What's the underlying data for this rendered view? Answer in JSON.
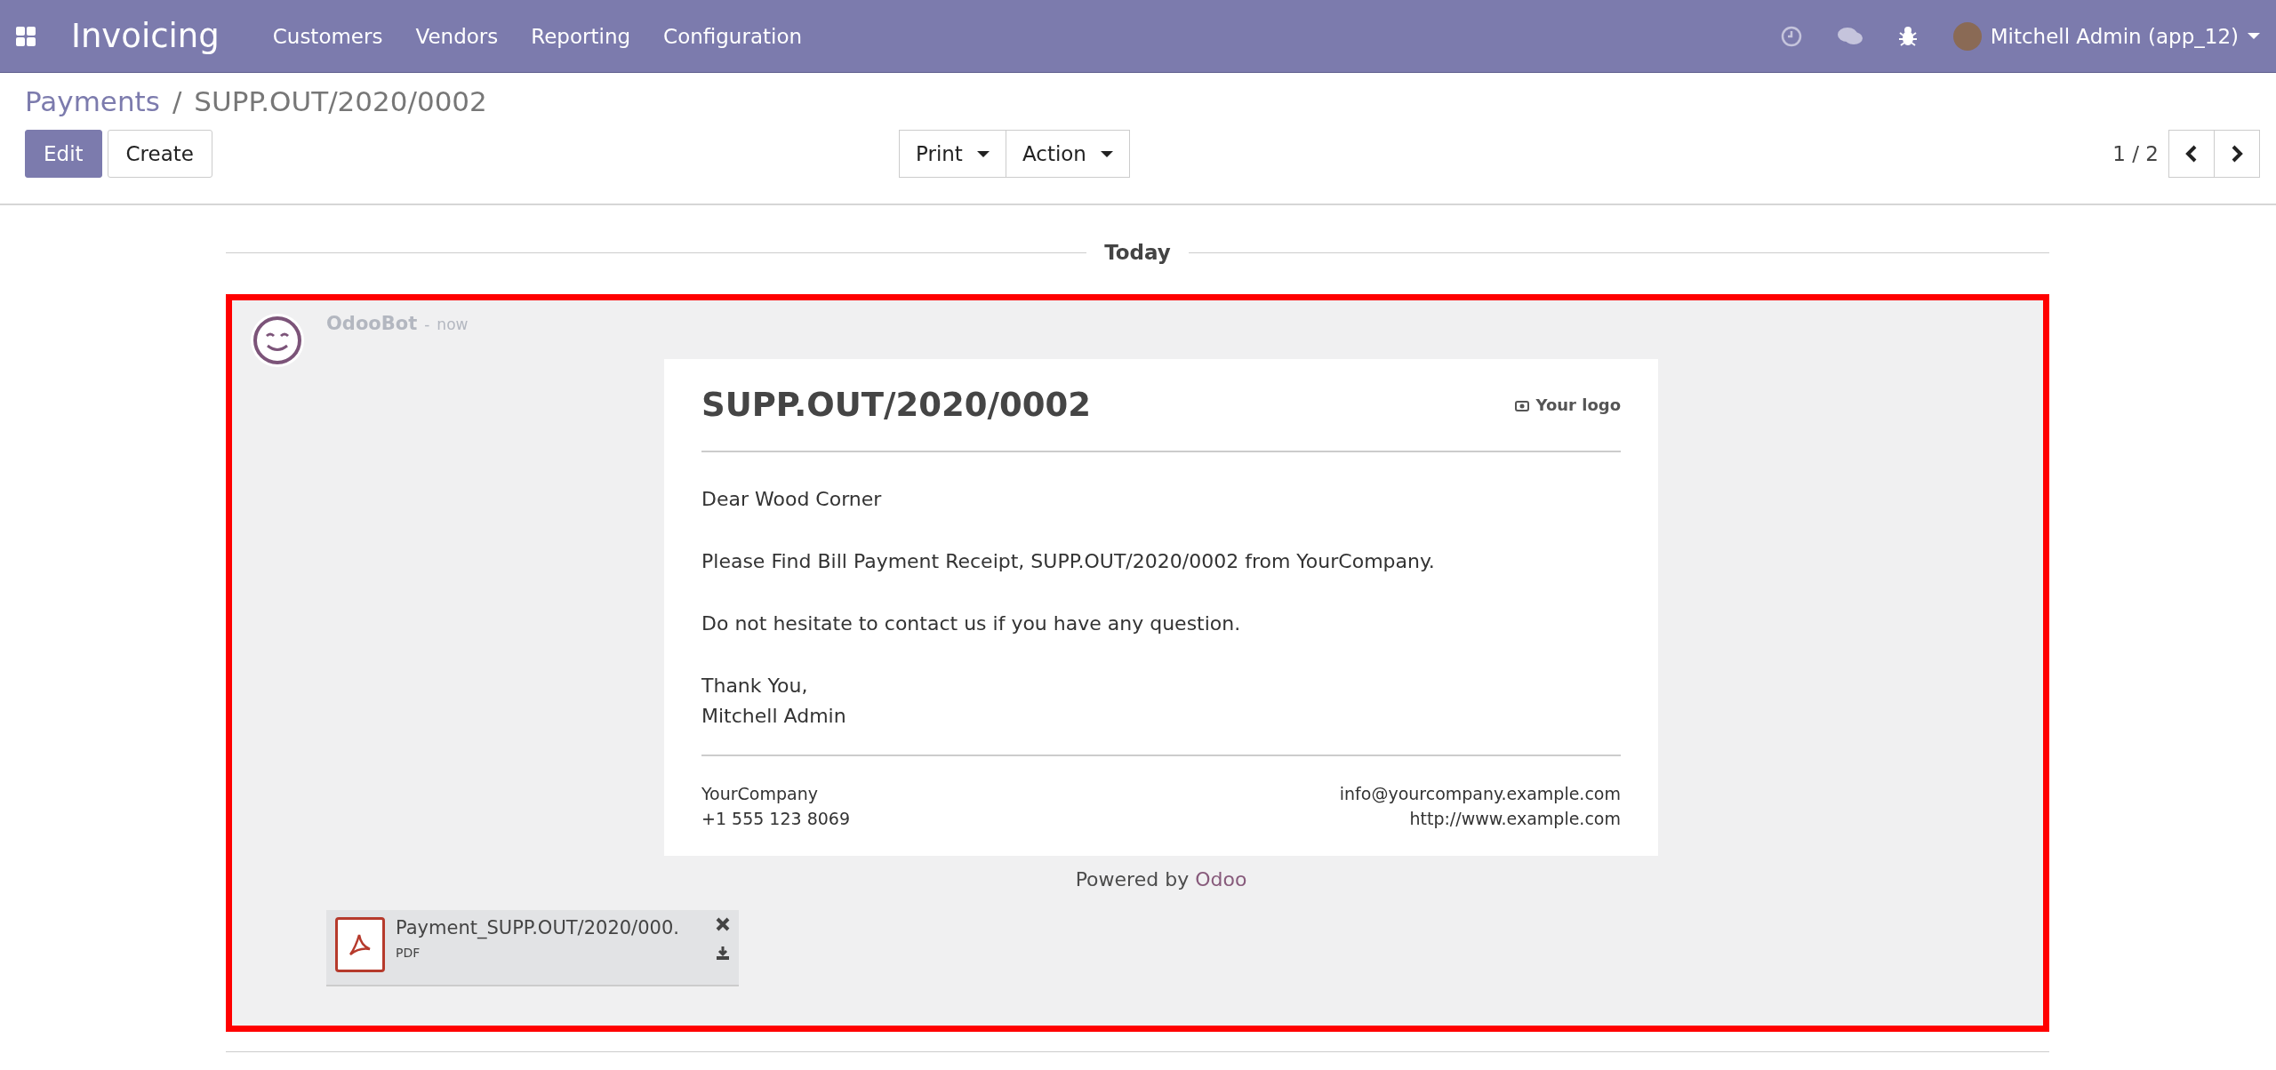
{
  "navbar": {
    "app_name": "Invoicing",
    "menu": [
      "Customers",
      "Vendors",
      "Reporting",
      "Configuration"
    ],
    "user": "Mitchell Admin (app_12)"
  },
  "breadcrumb": {
    "parent": "Payments",
    "separator": "/",
    "current": "SUPP.OUT/2020/0002"
  },
  "buttons": [
    {
      "label": "Edit",
      "kind": "primary"
    },
    {
      "label": "Create",
      "kind": "secondary"
    }
  ],
  "dropdowns": [
    "Print",
    "Action"
  ],
  "pager": "1 / 2",
  "date_separator": "Today",
  "message": {
    "author": "OdooBot",
    "separator": "-",
    "time": "now",
    "email": {
      "title": "SUPP.OUT/2020/0002",
      "logo": "Your logo",
      "paragraphs": [
        [
          "Dear Wood Corner"
        ],
        [
          "Please Find Bill Payment Receipt, SUPP.OUT/2020/0002 from YourCompany."
        ],
        [
          "Do not hesitate to contact us if you have any question."
        ],
        [
          "Thank You,",
          "Mitchell Admin"
        ]
      ],
      "footer_left": [
        "YourCompany",
        "+1 555 123 8069"
      ],
      "footer_right": [
        "info@yourcompany.example.com",
        "http://www.example.com"
      ]
    },
    "powered_by": "Powered by",
    "powered_link": "Odoo",
    "attachment": {
      "name": "Payment_SUPP.OUT/2020/000.",
      "type": "PDF"
    }
  }
}
